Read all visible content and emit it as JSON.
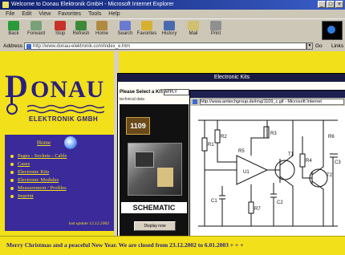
{
  "browser": {
    "title": "Welcome to Donau Elektronik GmbH - Microsoft Internet Explorer",
    "window_buttons": [
      "_",
      "□",
      "×"
    ],
    "menu": [
      "File",
      "Edit",
      "View",
      "Favorites",
      "Tools",
      "Help"
    ],
    "toolbar": [
      {
        "label": "Back",
        "icon": "back-arrow-icon",
        "color": "#2a9a3a"
      },
      {
        "label": "Forward",
        "icon": "forward-arrow-icon",
        "color": "#7aa07a"
      },
      {
        "label": "Stop",
        "icon": "stop-icon",
        "color": "#c8302a"
      },
      {
        "label": "Refresh",
        "icon": "refresh-icon",
        "color": "#3a8a3a"
      },
      {
        "label": "Home",
        "icon": "home-icon",
        "color": "#b08a40"
      },
      {
        "label": "Search",
        "icon": "search-icon",
        "color": "#6a7ad0"
      },
      {
        "label": "Favorites",
        "icon": "favorites-icon",
        "color": "#d8b030"
      },
      {
        "label": "History",
        "icon": "history-icon",
        "color": "#4a6ab0"
      },
      {
        "label": "Mail",
        "icon": "mail-icon",
        "color": "#d0c070"
      },
      {
        "label": "Print",
        "icon": "print-icon",
        "color": "#909090"
      }
    ],
    "address_label": "Address",
    "address_url": "http://www.donau-elektronik.com/index_e.htm",
    "go_label": "Go",
    "links_label": "Links"
  },
  "site": {
    "logo_initial": "D",
    "logo_rest": "ONAU",
    "logo_sub": "ELEKTRONIK GMBH",
    "nav_home": "Home",
    "nav_items": [
      "Pages - Sockets - Cable",
      "Cases",
      "Electronic Kits",
      "Electronic Modules",
      "Measurement / Profiles",
      "Imprint"
    ],
    "last_update": "last update 12.12.2002",
    "marquee": "Merry Christmas and a peaceful New Year. We are closed from 23.12.2002 to 6.01.2003 + + +"
  },
  "popup1": {
    "title": "Electronic Kits",
    "select_label": "Please Select a KIT by",
    "select_value": "APPLY",
    "sub_label": "technical data",
    "kit_number": "1109",
    "schematic_label": "SCHEMATIC",
    "kit_button": "Display now"
  },
  "popup2": {
    "url": "http://www.amtechgroup.de/img/1109_c.gif - Microsoft Internet",
    "labels": [
      "R1",
      "R2",
      "R3",
      "R4",
      "R5",
      "R6",
      "R7",
      "C1",
      "C2",
      "C3",
      "U1",
      "T1",
      "T2"
    ]
  }
}
